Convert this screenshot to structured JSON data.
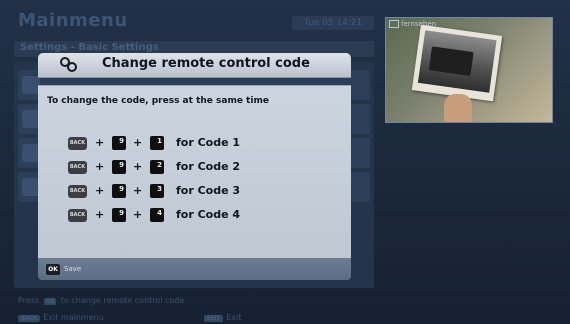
{
  "background": {
    "title": "Mainmenu",
    "clock": "Tue 05 14:21",
    "breadcrumb": "Settings - Basic Settings",
    "footer_hint_prefix": "Press",
    "footer_hint_key": "OK",
    "footer_hint_suffix": "to change remote control code",
    "footer_keys": [
      {
        "key": "BACK",
        "label": "Exit mainmenu"
      },
      {
        "key": "EXIT",
        "label": "Exit"
      }
    ]
  },
  "preview": {
    "tag": "fernsehen"
  },
  "dialog": {
    "title": "Change remote control code",
    "title_icon": "remote-code-icon",
    "instruction": "To change the code, press at the same time",
    "back_key": "BACK",
    "plus": "+",
    "codes": [
      {
        "first_key": "9",
        "second_key": "1",
        "label": "for Code 1"
      },
      {
        "first_key": "9",
        "second_key": "2",
        "label": "for Code 2"
      },
      {
        "first_key": "9",
        "second_key": "3",
        "label": "for Code 3"
      },
      {
        "first_key": "9",
        "second_key": "4",
        "label": "for Code 4"
      }
    ],
    "ok_key": "OK",
    "save_label": "Save"
  },
  "colors": {
    "dialog_body": "#c5cdd8",
    "dialog_header": "#cdd3db",
    "dialog_footer": "#65758b",
    "screen_bg": "#1d2a3c"
  }
}
